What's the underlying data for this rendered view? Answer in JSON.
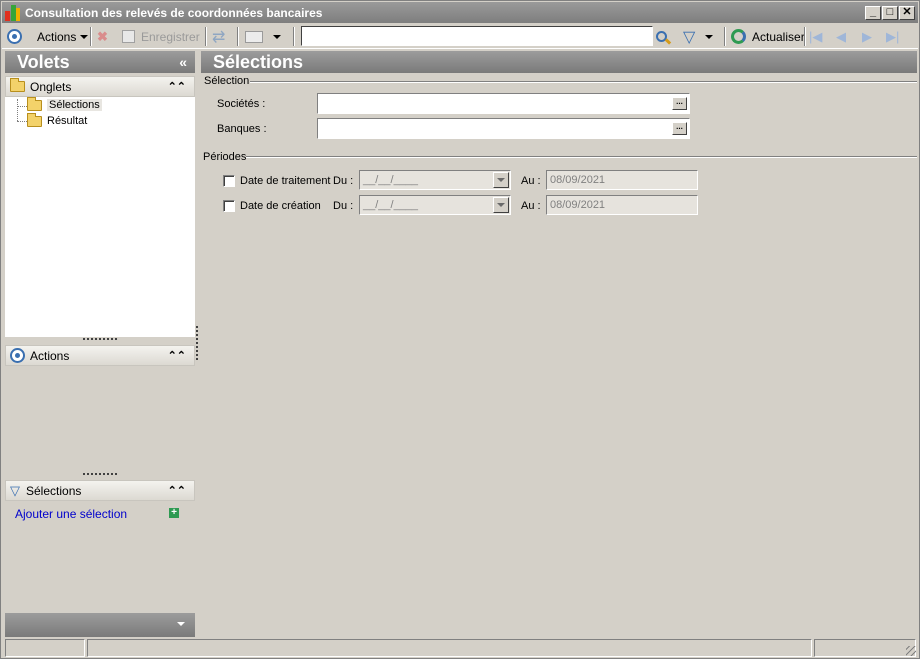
{
  "window": {
    "title": "Consultation des relevés de coordonnées bancaires",
    "controls": [
      "_",
      "□",
      "✕"
    ]
  },
  "toolbar": {
    "actions_label": "Actions",
    "save_label": "Enregistrer",
    "search_value": "",
    "refresh_label": "Actualiser"
  },
  "sidebar": {
    "title": "Volets",
    "collapse_glyph": "«",
    "onglets": {
      "title": "Onglets",
      "items": [
        "Sélections",
        "Résultat"
      ]
    },
    "actions": {
      "title": "Actions"
    },
    "selections": {
      "title": "Sélections",
      "add_link": "Ajouter une sélection"
    },
    "section_toggle_glyph": "⌃"
  },
  "main": {
    "title": "Sélections",
    "selection_group": {
      "label": "Sélection",
      "fields": [
        {
          "label": "Sociétés :",
          "value": ""
        },
        {
          "label": "Banques :",
          "value": ""
        }
      ],
      "button_glyph": "..."
    },
    "periods_group": {
      "label": "Périodes",
      "rows": [
        {
          "label": "Date de traitement",
          "checked": false,
          "du_label": "Du :",
          "du_value": "__/__/____",
          "au_label": "Au :",
          "au_value": "08/09/2021"
        },
        {
          "label": "Date de création",
          "checked": false,
          "du_label": "Du :",
          "du_value": "__/__/____",
          "au_label": "Au :",
          "au_value": "08/09/2021"
        }
      ]
    }
  }
}
